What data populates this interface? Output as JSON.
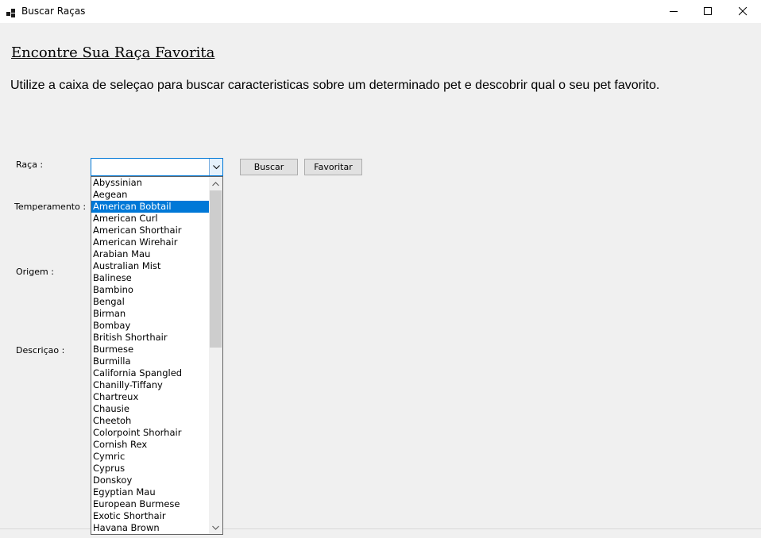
{
  "window": {
    "title": "Buscar Raças",
    "icon": "app-grid-icon"
  },
  "main": {
    "heading": "Encontre Sua Raça Favorita",
    "intro": "Utilize a caixa de seleçao para buscar caracteristicas sobre um determinado pet e descobrir qual o seu pet favorito."
  },
  "form": {
    "raca_label": "Raça :",
    "temperamento_label": "Temperamento :",
    "origem_label": "Origem :",
    "descricao_label": "Descriçao :",
    "combo_value": "",
    "buscar_label": "Buscar",
    "favoritar_label": "Favoritar"
  },
  "dropdown": {
    "selected": "American Bobtail",
    "items": [
      "Abyssinian",
      "Aegean",
      "American Bobtail",
      "American Curl",
      "American Shorthair",
      "American Wirehair",
      "Arabian Mau",
      "Australian Mist",
      "Balinese",
      "Bambino",
      "Bengal",
      "Birman",
      "Bombay",
      "British Shorthair",
      "Burmese",
      "Burmilla",
      "California Spangled",
      "Chanilly-Tiffany",
      "Chartreux",
      "Chausie",
      "Cheetoh",
      "Colorpoint Shorhair",
      "Cornish Rex",
      "Cymric",
      "Cyprus",
      "Donskoy",
      "Egyptian Mau",
      "European Burmese",
      "Exotic Shorthair",
      "Havana Brown"
    ]
  },
  "colors": {
    "accent": "#0078d7",
    "window_bg": "#f0f0f0"
  }
}
